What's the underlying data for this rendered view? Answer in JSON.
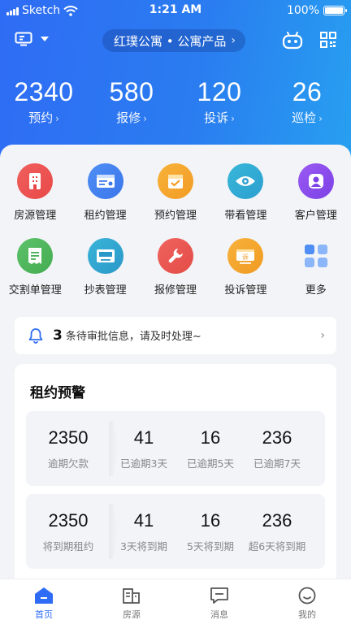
{
  "status_bar": {
    "carrier": "Sketch",
    "time": "1:21 AM",
    "battery": "100%",
    "battery_level": 1.0
  },
  "topbar": {
    "project": "红璞公寓 • 公寓产品"
  },
  "stats": [
    {
      "value": "2340",
      "label": "预约"
    },
    {
      "value": "580",
      "label": "报修"
    },
    {
      "value": "120",
      "label": "投诉"
    },
    {
      "value": "26",
      "label": "巡检"
    }
  ],
  "menu": [
    {
      "label": "房源管理",
      "icon": "building-icon",
      "color": "#f0605d",
      "color2": "#e84848"
    },
    {
      "label": "租约管理",
      "icon": "contract-icon",
      "color": "#4f8ef5",
      "color2": "#3a76ea"
    },
    {
      "label": "预约管理",
      "icon": "calendar-check-icon",
      "color": "#f8b23b",
      "color2": "#f29c23"
    },
    {
      "label": "带看管理",
      "icon": "eye-icon",
      "color": "#39b7d8",
      "color2": "#2a9fd0"
    },
    {
      "label": "客户管理",
      "icon": "user-icon",
      "color": "#9a5af2",
      "color2": "#7c41e6"
    },
    {
      "label": "交割单管理",
      "icon": "receipt-icon",
      "color": "#5ec26a",
      "color2": "#43ac51"
    },
    {
      "label": "抄表管理",
      "icon": "meter-icon",
      "color": "#3ab4d8",
      "color2": "#2a98c8"
    },
    {
      "label": "报修管理",
      "icon": "wrench-icon",
      "color": "#f0645f",
      "color2": "#e34b46"
    },
    {
      "label": "投诉管理",
      "icon": "complaint-icon",
      "color": "#f8b23b",
      "color2": "#ef9a22",
      "badge": "诉"
    },
    {
      "label": "更多",
      "icon": "grid-more-icon",
      "color": "#4f8ef5",
      "color2": "#4f8ef5"
    }
  ],
  "notice": {
    "count": "3",
    "text": "条待审批信息，请及时处理~"
  },
  "warning": {
    "title": "租约预警",
    "rows": [
      [
        {
          "value": "2350",
          "label": "逾期欠款"
        },
        {
          "value": "41",
          "label": "已逾期3天"
        },
        {
          "value": "16",
          "label": "已逾期5天"
        },
        {
          "value": "236",
          "label": "已逾期7天"
        }
      ],
      [
        {
          "value": "2350",
          "label": "将到期租约"
        },
        {
          "value": "41",
          "label": "3天将到期"
        },
        {
          "value": "16",
          "label": "5天将到期"
        },
        {
          "value": "236",
          "label": "超6天将到期"
        }
      ]
    ]
  },
  "tabs": [
    {
      "label": "首页",
      "icon": "home-icon",
      "active": true
    },
    {
      "label": "房源",
      "icon": "house-source-icon",
      "active": false
    },
    {
      "label": "消息",
      "icon": "message-icon",
      "active": false
    },
    {
      "label": "我的",
      "icon": "profile-smile-icon",
      "active": false
    }
  ],
  "colors": {
    "primary": "#2f6cf5",
    "gradient_end": "#27a0f0",
    "background": "#f2f4f7"
  }
}
